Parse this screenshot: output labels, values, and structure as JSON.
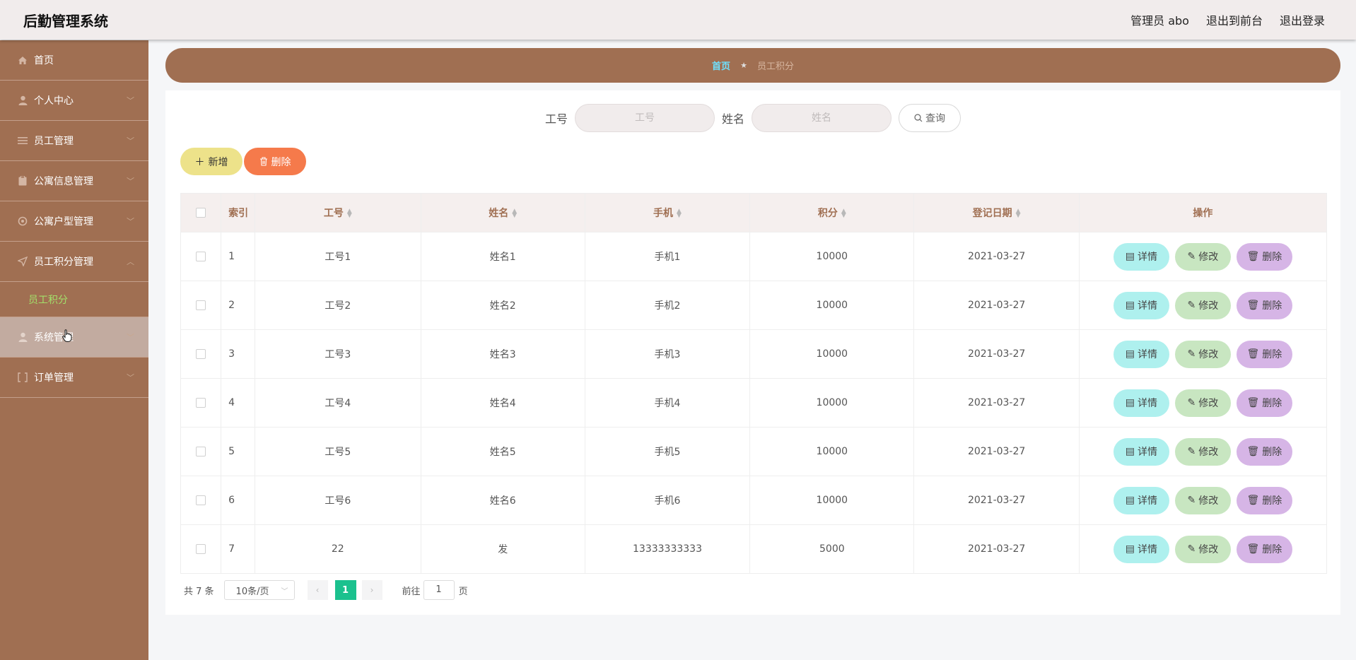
{
  "header": {
    "title": "后勤管理系统",
    "user_label": "管理员 abo",
    "to_front_label": "退出到前台",
    "logout_label": "退出登录"
  },
  "sidebar": {
    "items": [
      {
        "label": "首页",
        "icon": "home-icon"
      },
      {
        "label": "个人中心",
        "icon": "user-icon"
      },
      {
        "label": "员工管理",
        "icon": "list-icon"
      },
      {
        "label": "公寓信息管理",
        "icon": "clipboard-icon"
      },
      {
        "label": "公寓户型管理",
        "icon": "gear-icon"
      },
      {
        "label": "员工积分管理",
        "icon": "send-icon"
      },
      {
        "label": "系统管理",
        "icon": "user-icon"
      },
      {
        "label": "订单管理",
        "icon": "bracket-icon"
      }
    ],
    "submenu_label": "员工积分"
  },
  "breadcrumb": {
    "home": "首页",
    "current": "员工积分"
  },
  "search": {
    "field1_label": "工号",
    "field1_placeholder": "工号",
    "field2_label": "姓名",
    "field2_placeholder": "姓名",
    "query_label": "查询"
  },
  "toolbar": {
    "add_label": "新增",
    "delete_label": "删除"
  },
  "table": {
    "headers": {
      "index": "索引",
      "job_no": "工号",
      "name": "姓名",
      "phone": "手机",
      "points": "积分",
      "date": "登记日期",
      "ops": "操作"
    },
    "op_labels": {
      "detail": "详情",
      "edit": "修改",
      "remove": "删除"
    },
    "rows": [
      {
        "index": "1",
        "job_no": "工号1",
        "name": "姓名1",
        "phone": "手机1",
        "points": "10000",
        "date": "2021-03-27"
      },
      {
        "index": "2",
        "job_no": "工号2",
        "name": "姓名2",
        "phone": "手机2",
        "points": "10000",
        "date": "2021-03-27"
      },
      {
        "index": "3",
        "job_no": "工号3",
        "name": "姓名3",
        "phone": "手机3",
        "points": "10000",
        "date": "2021-03-27"
      },
      {
        "index": "4",
        "job_no": "工号4",
        "name": "姓名4",
        "phone": "手机4",
        "points": "10000",
        "date": "2021-03-27"
      },
      {
        "index": "5",
        "job_no": "工号5",
        "name": "姓名5",
        "phone": "手机5",
        "points": "10000",
        "date": "2021-03-27"
      },
      {
        "index": "6",
        "job_no": "工号6",
        "name": "姓名6",
        "phone": "手机6",
        "points": "10000",
        "date": "2021-03-27"
      },
      {
        "index": "7",
        "job_no": "22",
        "name": "发",
        "phone": "13333333333",
        "points": "5000",
        "date": "2021-03-27"
      }
    ]
  },
  "pagination": {
    "total_label": "共 7 条",
    "page_size": "10条/页",
    "current_page": "1",
    "goto_label": "前往",
    "goto_value": "1",
    "page_suffix": "页"
  },
  "colors": {
    "brand": "#a06f52",
    "page_active": "#1bc18e",
    "detail_btn": "#aef0ee",
    "edit_btn": "#c8e6c1",
    "remove_btn": "#d6b5e6"
  }
}
